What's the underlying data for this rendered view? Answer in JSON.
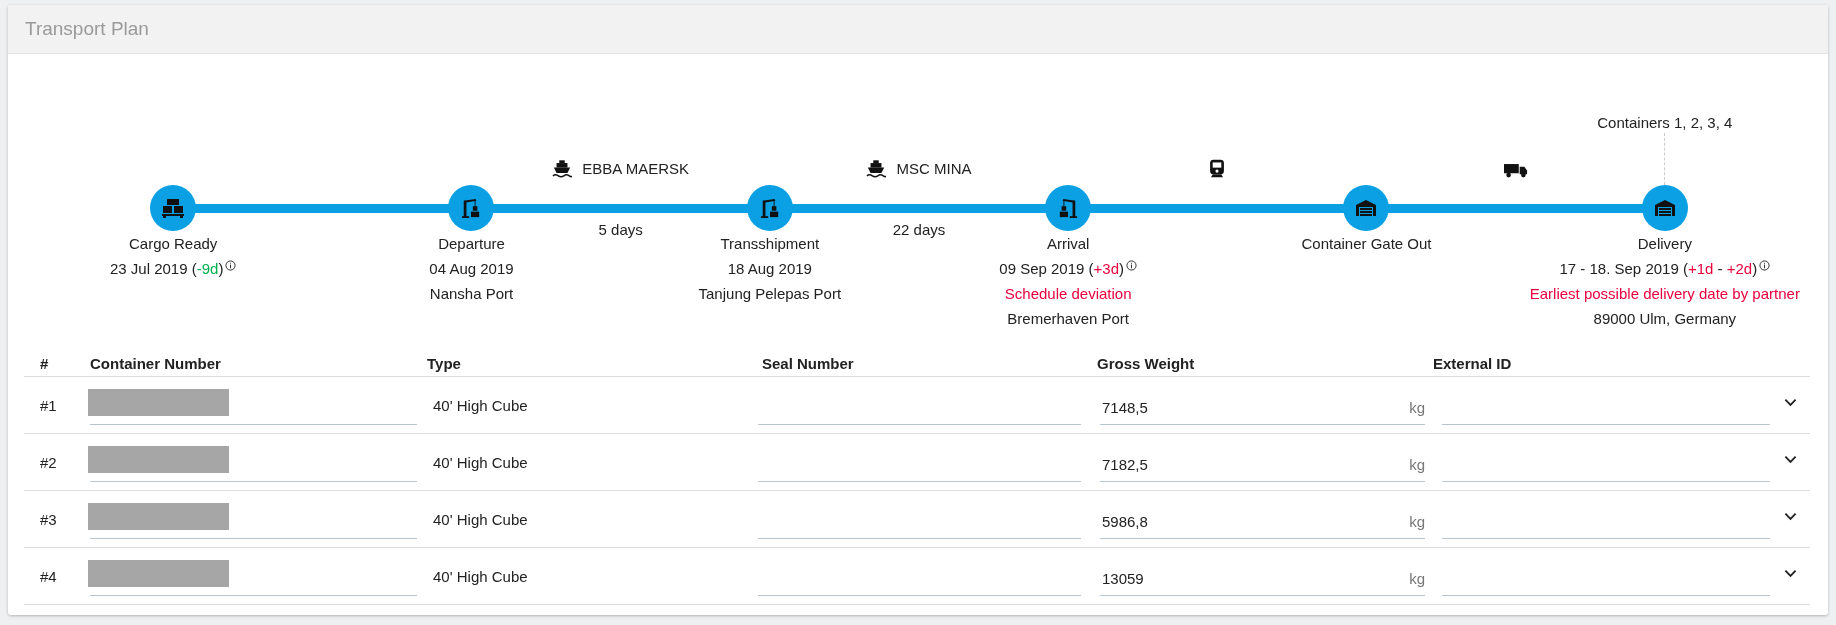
{
  "panel": {
    "title": "Transport Plan"
  },
  "timeline": {
    "milestones": [
      {
        "kind": "pallet",
        "label": "Cargo Ready",
        "date_parts": [
          {
            "text": "23 Jul 2019  ("
          },
          {
            "text": "-9d",
            "color": "#00b050"
          },
          {
            "text": ")"
          }
        ],
        "info": true
      },
      {
        "kind": "crane",
        "label": "Departure",
        "date_parts": [
          {
            "text": "04 Aug 2019"
          }
        ],
        "location": "Nansha Port"
      },
      {
        "kind": "crane",
        "label": "Transshipment",
        "date_parts": [
          {
            "text": "18 Aug 2019"
          }
        ],
        "location": "Tanjung Pelepas Port",
        "leg": {
          "kind": "ship",
          "vessel": "EBBA MAERSK",
          "duration": "5 days"
        }
      },
      {
        "kind": "crane-arrival",
        "label": "Arrival",
        "date_parts": [
          {
            "text": "09 Sep 2019  ("
          },
          {
            "text": "+3d",
            "color": "#e8003d"
          },
          {
            "text": ")"
          }
        ],
        "info": true,
        "alert": "Schedule deviation",
        "location": "Bremerhaven Port",
        "leg": {
          "kind": "ship",
          "vessel": "MSC MINA",
          "duration": "22 days"
        }
      },
      {
        "kind": "warehouse",
        "label": "Container Gate Out",
        "leg": {
          "kind": "train"
        }
      },
      {
        "kind": "warehouse",
        "label": "Delivery",
        "date_parts": [
          {
            "text": "17 - 18. Sep 2019 ("
          },
          {
            "text": "+1d",
            "color": "#e8003d"
          },
          {
            "text": " - "
          },
          {
            "text": "+2d",
            "color": "#e8003d"
          },
          {
            "text": ")"
          }
        ],
        "info": true,
        "alert": "Earliest possible delivery date by partner",
        "location": "89000 Ulm, Germany",
        "note_above": "Containers 1, 2, 3, 4",
        "leg": {
          "kind": "truck"
        }
      }
    ]
  },
  "table": {
    "columns": [
      "#",
      "Container Number",
      "Type",
      "Seal Number",
      "Gross Weight",
      "External ID"
    ],
    "rows": [
      {
        "number": "#1",
        "type": "40' High Cube",
        "gross_weight": "7148,5",
        "unit": "kg",
        "expanded": false
      },
      {
        "number": "#2",
        "type": "40' High Cube",
        "gross_weight": "7182,5",
        "unit": "kg",
        "expanded": false
      },
      {
        "number": "#3",
        "type": "40' High Cube",
        "gross_weight": "5986,8",
        "unit": "kg",
        "expanded": false
      },
      {
        "number": "#4",
        "type": "40' High Cube",
        "gross_weight": "13059",
        "unit": "kg",
        "expanded": false
      }
    ]
  }
}
